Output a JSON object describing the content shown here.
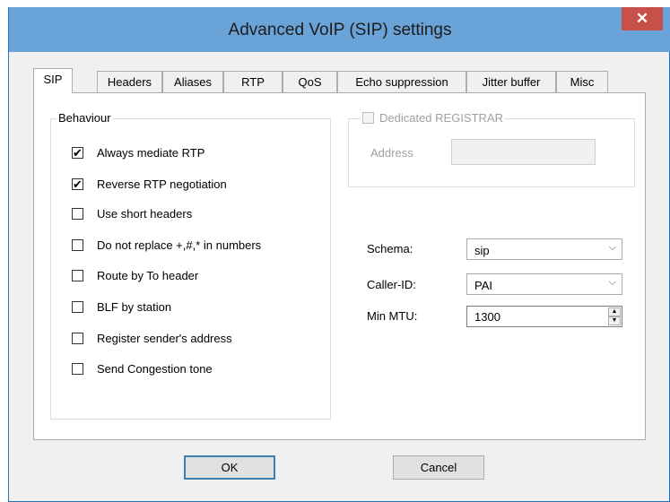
{
  "window": {
    "title": "Advanced VoIP (SIP) settings",
    "close_glyph": "✕"
  },
  "tabs": [
    "SIP",
    "Headers",
    "Aliases",
    "RTP",
    "QoS",
    "Echo suppression",
    "Jitter buffer",
    "Misc"
  ],
  "active_tab": "SIP",
  "behaviour": {
    "label": "Behaviour",
    "items": [
      {
        "label": "Always mediate RTP",
        "checked": true
      },
      {
        "label": "Reverse RTP negotiation",
        "checked": true
      },
      {
        "label": "Use short headers",
        "checked": false
      },
      {
        "label": "Do not replace +,#,* in numbers",
        "checked": false
      },
      {
        "label": "Route by To header",
        "checked": false
      },
      {
        "label": "BLF by station",
        "checked": false
      },
      {
        "label": "Register sender's address",
        "checked": false
      },
      {
        "label": "Send Congestion tone",
        "checked": false
      }
    ]
  },
  "registrar": {
    "label": "Dedicated REGISTRAR",
    "checked": false,
    "enabled": false,
    "address_label": "Address",
    "address_value": ""
  },
  "fields": {
    "schema_label": "Schema:",
    "schema_value": "sip",
    "callerid_label": "Caller-ID:",
    "callerid_value": "PAI",
    "mtu_label": "Min MTU:",
    "mtu_value": "1300"
  },
  "buttons": {
    "ok": "OK",
    "cancel": "Cancel"
  },
  "icons": {
    "check": "check-icon",
    "dropdown": "chevron-down-icon",
    "spin": "spin-arrows-icon",
    "close": "close-icon"
  }
}
